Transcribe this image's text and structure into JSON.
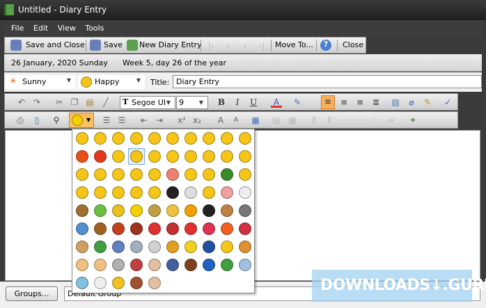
{
  "window": {
    "title": "Untitled - Diary Entry"
  },
  "menu": [
    "File",
    "Edit",
    "View",
    "Tools"
  ],
  "toolbar": {
    "save_close": "Save and Close",
    "save": "Save",
    "new_entry": "New Diary Entry",
    "move_to": "Move To...",
    "close": "Close"
  },
  "datebar": {
    "date": "26 January, 2020 Sunday",
    "week": "Week 5, day 26 of the year"
  },
  "props": {
    "weather": "Sunny",
    "mood": "Happy",
    "title_label": "Title:",
    "title_value": "Diary Entry"
  },
  "format": {
    "font": "Segoe UI",
    "size": "9"
  },
  "bottom": {
    "groups_button": "Groups...",
    "group_value": "Default Group"
  },
  "watermark": "DOWNLOADS↓.GURU",
  "emoticons": {
    "selected_index": 13,
    "count": 85,
    "colors": [
      "#f5c518",
      "#f5c518",
      "#f5c518",
      "#f5c518",
      "#f5c518",
      "#f5c518",
      "#f5c518",
      "#f5c518",
      "#f5c518",
      "#f5c518",
      "#e8501a",
      "#e23a1a",
      "#f5c518",
      "#f5c518",
      "#f5c518",
      "#f5c518",
      "#f5c518",
      "#f5c518",
      "#f5c518",
      "#f5c518",
      "#f5c518",
      "#f5c518",
      "#f5c518",
      "#f5c518",
      "#f5c518",
      "#f08070",
      "#f5c518",
      "#f5c518",
      "#3a8a2a",
      "#f5c518",
      "#f5c518",
      "#f5c518",
      "#f5c518",
      "#f5c518",
      "#f5c518",
      "#222222",
      "#dddddd",
      "#f5c518",
      "#f0a0a0",
      "#eeeeee",
      "#a07030",
      "#6ac040",
      "#e8c020",
      "#f5d000",
      "#c0a040",
      "#f0c040",
      "#f5a000",
      "#222222",
      "#c08040",
      "#777777",
      "#5090d0",
      "#a06020",
      "#c04020",
      "#a03020",
      "#e03030",
      "#c03030",
      "#e03030",
      "#e03050",
      "#f06020",
      "#d03040",
      "#d0a060",
      "#40a040",
      "#6080c0",
      "#a0b0c0",
      "#d0d0d0",
      "#e0a020",
      "#f0d020",
      "#2050a0",
      "#f5c518",
      "#e09030",
      "#f0c080",
      "#f0c080",
      "#b0b0b0",
      "#c04040",
      "#e0c0a0",
      "#4060a0",
      "#804020",
      "#2060c0",
      "#40a040",
      "#a0c0e0",
      "#80c0e0",
      "#eeeeee",
      "#f0c020",
      "#a05030",
      "#e0c0a0"
    ]
  }
}
